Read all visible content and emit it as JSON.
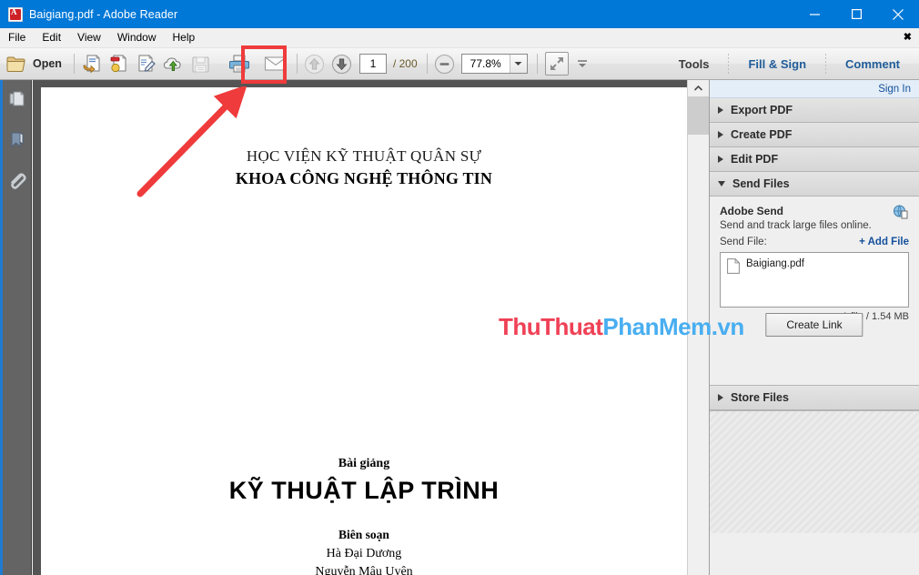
{
  "window": {
    "title": "Baigiang.pdf - Adobe Reader",
    "app_icon": "pdf-file-icon",
    "controls": [
      {
        "name": "minimize",
        "glyph": "minimize-icon"
      },
      {
        "name": "maximize",
        "glyph": "maximize-icon"
      },
      {
        "name": "close",
        "glyph": "close-icon"
      }
    ],
    "titlebar_color": "#0078d7"
  },
  "menubar": {
    "items": [
      "File",
      "Edit",
      "View",
      "Window",
      "Help"
    ],
    "close_marker": "✖"
  },
  "toolbar": {
    "open_label": "Open",
    "page_current": "1",
    "page_total": "/ 200",
    "zoom_value": "77.8%",
    "tools_label": "Tools",
    "fill_sign_label": "Fill & Sign",
    "comment_label": "Comment",
    "icons": [
      "open-folder-icon",
      "create-pdf-icon",
      "combine-files-icon",
      "edit-pdf-icon",
      "upload-cloud-icon",
      "save-icon",
      "print-icon",
      "email-icon",
      "previous-page-icon",
      "next-page-icon",
      "zoom-out-icon",
      "zoom-dropdown-icon",
      "fit-page-icon",
      "view-dropdown-icon"
    ]
  },
  "left_rail": {
    "items": [
      {
        "name": "page-thumbnails",
        "icon": "pages-icon"
      },
      {
        "name": "bookmarks",
        "icon": "bookmark-icon"
      },
      {
        "name": "attachments",
        "icon": "paperclip-icon"
      }
    ],
    "accent_color": "#1e7bd1"
  },
  "document": {
    "header_line1": "HỌC VIỆN KỸ THUẬT QUÂN SỰ",
    "header_line2": "KHOA CÔNG NGHỆ THÔNG TIN",
    "subtitle": "Bài giảng",
    "title": "KỸ THUẬT LẬP TRÌNH",
    "byline": "Biên soạn",
    "author1": "Hà Đại Dương",
    "author2": "Nguyễn Mậu Uyên"
  },
  "right_panel": {
    "sign_in": "Sign In",
    "sections": [
      {
        "label": "Export PDF",
        "expanded": false
      },
      {
        "label": "Create PDF",
        "expanded": false
      },
      {
        "label": "Edit PDF",
        "expanded": false
      },
      {
        "label": "Send Files",
        "expanded": true
      }
    ],
    "store_files_label": "Store Files",
    "send_files": {
      "heading": "Adobe Send",
      "description": "Send and track large files online.",
      "send_file_label": "Send File:",
      "add_file_label": "+ Add File",
      "file_name": "Baigiang.pdf",
      "file_summary": "1 file / 1.54 MB",
      "create_link_label": "Create Link",
      "cloud_icon": "adobe-send-cloud-icon"
    }
  },
  "annotations": {
    "highlight_target": "print-icon",
    "highlight_color": "#ef3b3b",
    "arrow_color": "#ef3b3b",
    "watermark_part1": "ThuThuat",
    "watermark_part2": "PhanMem.vn",
    "watermark_color1": "#ef4156",
    "watermark_color2": "#49aef0"
  }
}
